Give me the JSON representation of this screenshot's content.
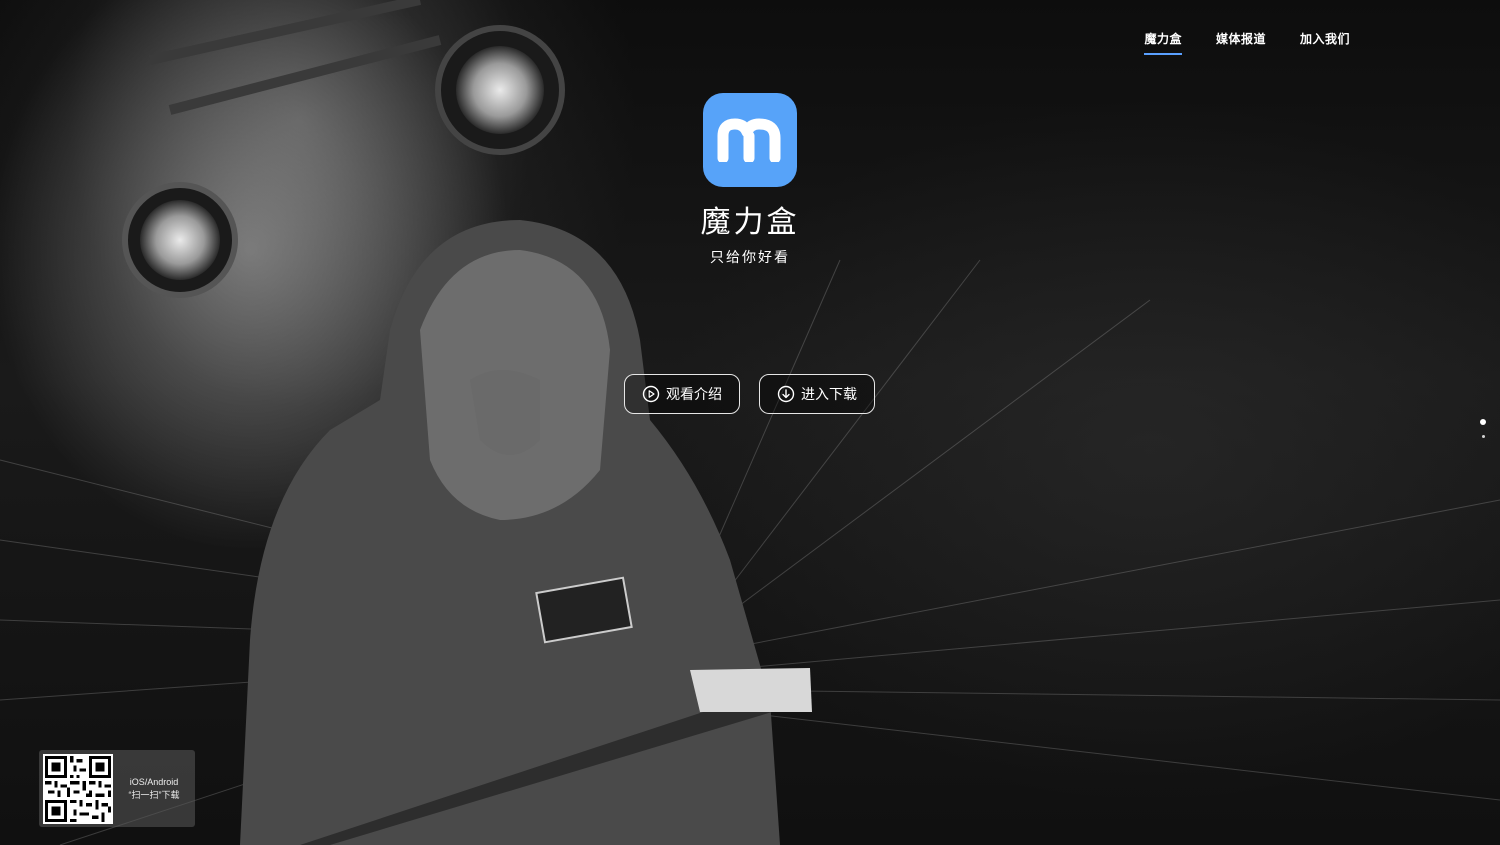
{
  "nav": {
    "items": [
      {
        "label": "魔力盒",
        "active": true
      },
      {
        "label": "媒体报道",
        "active": false
      },
      {
        "label": "加入我们",
        "active": false
      }
    ]
  },
  "hero": {
    "logo_letter": "m",
    "app_name": "魔力盒",
    "slogan": "只给你好看"
  },
  "actions": {
    "watch_label": "观看介绍",
    "download_label": "进入下载",
    "watch_icon": "play-circle-icon",
    "download_icon": "download-circle-icon"
  },
  "pager": {
    "total": 2,
    "active_index": 0
  },
  "download_card": {
    "platform": "iOS/Android",
    "hint": "“扫一扫”下载"
  },
  "colors": {
    "accent": "#5aa0ff",
    "logo_bg": "#57a3f9"
  }
}
